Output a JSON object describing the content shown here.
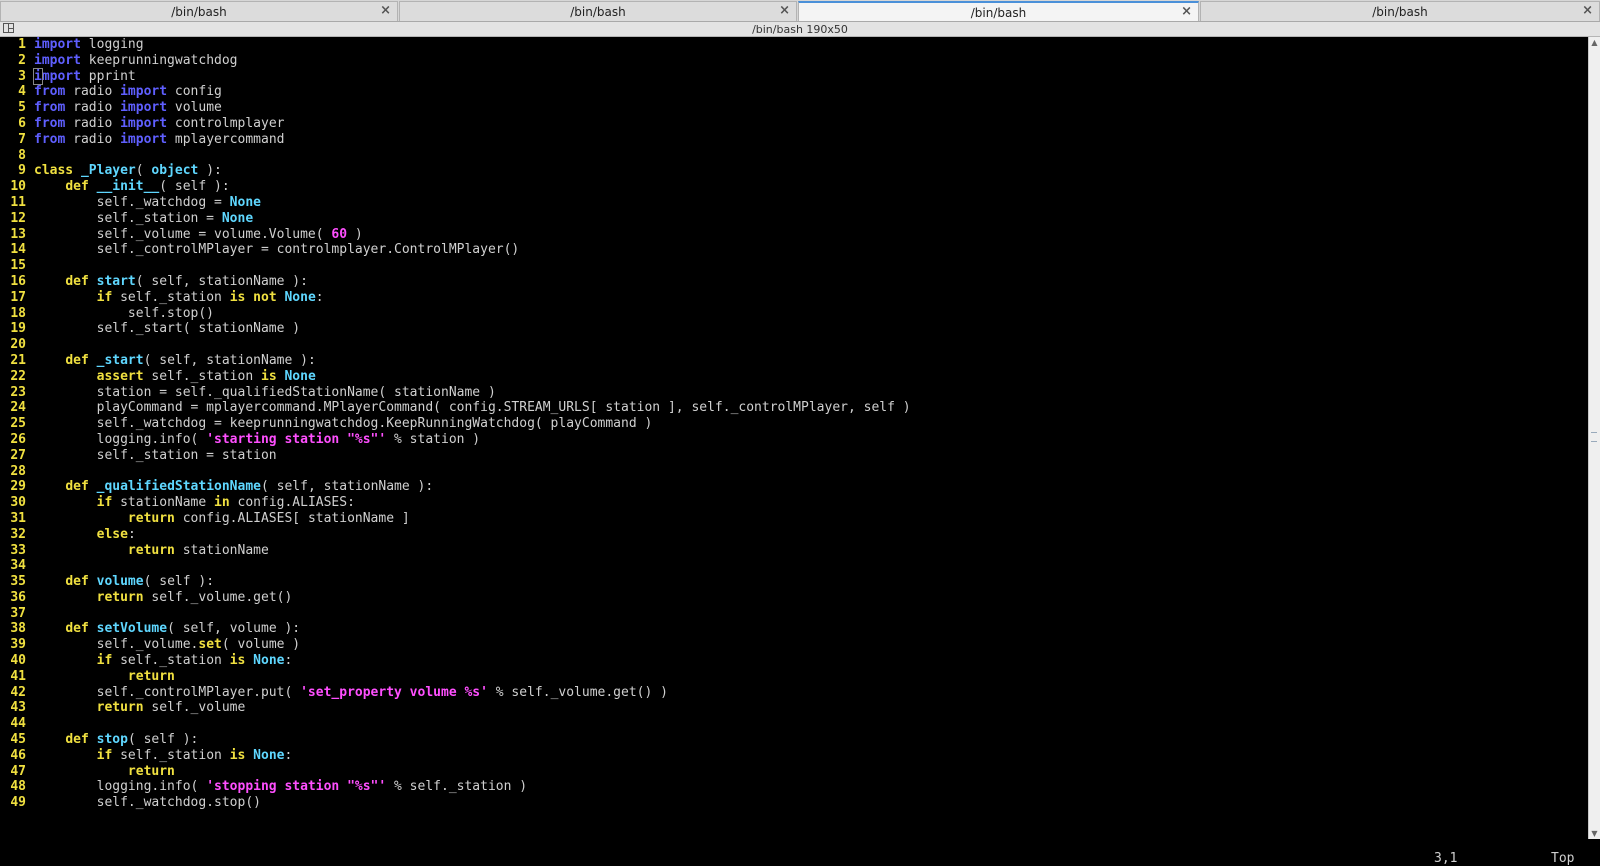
{
  "tabs": [
    {
      "label": "/bin/bash",
      "active": false
    },
    {
      "label": "/bin/bash",
      "active": false
    },
    {
      "label": "/bin/bash",
      "active": true
    },
    {
      "label": "/bin/bash",
      "active": false
    }
  ],
  "tab_close_icon": "×",
  "infobar": {
    "title": "/bin/bash 190x50"
  },
  "code_lines": [
    [
      [
        "kw",
        "import"
      ],
      [
        "n",
        " logging"
      ]
    ],
    [
      [
        "kw",
        "import"
      ],
      [
        "n",
        " keeprunningwatchdog"
      ]
    ],
    [
      [
        "kw",
        "import"
      ],
      [
        "n",
        " pprint"
      ]
    ],
    [
      [
        "kw",
        "from"
      ],
      [
        "n",
        " radio "
      ],
      [
        "kw",
        "import"
      ],
      [
        "n",
        " config"
      ]
    ],
    [
      [
        "kw",
        "from"
      ],
      [
        "n",
        " radio "
      ],
      [
        "kw",
        "import"
      ],
      [
        "n",
        " volume"
      ]
    ],
    [
      [
        "kw",
        "from"
      ],
      [
        "n",
        " radio "
      ],
      [
        "kw",
        "import"
      ],
      [
        "n",
        " controlmplayer"
      ]
    ],
    [
      [
        "kw",
        "from"
      ],
      [
        "n",
        " radio "
      ],
      [
        "kw",
        "import"
      ],
      [
        "n",
        " mplayercommand"
      ]
    ],
    [],
    [
      [
        "st",
        "class"
      ],
      [
        "n",
        " "
      ],
      [
        "fn",
        "_Player"
      ],
      [
        "n",
        "( "
      ],
      [
        "bi",
        "object"
      ],
      [
        "n",
        " ):"
      ]
    ],
    [
      [
        "n",
        "    "
      ],
      [
        "st",
        "def"
      ],
      [
        "n",
        " "
      ],
      [
        "fn",
        "__init__"
      ],
      [
        "n",
        "( self ):"
      ]
    ],
    [
      [
        "n",
        "        self._watchdog = "
      ],
      [
        "bi",
        "None"
      ]
    ],
    [
      [
        "n",
        "        self._station = "
      ],
      [
        "bi",
        "None"
      ]
    ],
    [
      [
        "n",
        "        self._volume = volume.Volume( "
      ],
      [
        "num",
        "60"
      ],
      [
        "n",
        " )"
      ]
    ],
    [
      [
        "n",
        "        self._controlMPlayer = controlmplayer.ControlMPlayer()"
      ]
    ],
    [],
    [
      [
        "n",
        "    "
      ],
      [
        "st",
        "def"
      ],
      [
        "n",
        " "
      ],
      [
        "fn",
        "start"
      ],
      [
        "n",
        "( self, stationName ):"
      ]
    ],
    [
      [
        "n",
        "        "
      ],
      [
        "st",
        "if"
      ],
      [
        "n",
        " self._station "
      ],
      [
        "st",
        "is not"
      ],
      [
        "n",
        " "
      ],
      [
        "bi",
        "None"
      ],
      [
        "n",
        ":"
      ]
    ],
    [
      [
        "n",
        "            self.stop()"
      ]
    ],
    [
      [
        "n",
        "        self._start( stationName )"
      ]
    ],
    [],
    [
      [
        "n",
        "    "
      ],
      [
        "st",
        "def"
      ],
      [
        "n",
        " "
      ],
      [
        "fn",
        "_start"
      ],
      [
        "n",
        "( self, stationName ):"
      ]
    ],
    [
      [
        "n",
        "        "
      ],
      [
        "st",
        "assert"
      ],
      [
        "n",
        " self._station "
      ],
      [
        "st",
        "is"
      ],
      [
        "n",
        " "
      ],
      [
        "bi",
        "None"
      ]
    ],
    [
      [
        "n",
        "        station = self._qualifiedStationName( stationName )"
      ]
    ],
    [
      [
        "n",
        "        playCommand = mplayercommand.MPlayerCommand( config.STREAM_URLS[ station ], self._controlMPlayer, self )"
      ]
    ],
    [
      [
        "n",
        "        self._watchdog = keeprunningwatchdog.KeepRunningWatchdog( playCommand )"
      ]
    ],
    [
      [
        "n",
        "        logging.info( "
      ],
      [
        "str",
        "'starting station \"%s\"'"
      ],
      [
        "n",
        " % station )"
      ]
    ],
    [
      [
        "n",
        "        self._station = station"
      ]
    ],
    [],
    [
      [
        "n",
        "    "
      ],
      [
        "st",
        "def"
      ],
      [
        "n",
        " "
      ],
      [
        "fn",
        "_qualifiedStationName"
      ],
      [
        "n",
        "( self, stationName ):"
      ]
    ],
    [
      [
        "n",
        "        "
      ],
      [
        "st",
        "if"
      ],
      [
        "n",
        " stationName "
      ],
      [
        "st",
        "in"
      ],
      [
        "n",
        " config.ALIASES:"
      ]
    ],
    [
      [
        "n",
        "            "
      ],
      [
        "st",
        "return"
      ],
      [
        "n",
        " config.ALIASES[ stationName ]"
      ]
    ],
    [
      [
        "n",
        "        "
      ],
      [
        "st",
        "else"
      ],
      [
        "n",
        ":"
      ]
    ],
    [
      [
        "n",
        "            "
      ],
      [
        "st",
        "return"
      ],
      [
        "n",
        " stationName"
      ]
    ],
    [],
    [
      [
        "n",
        "    "
      ],
      [
        "st",
        "def"
      ],
      [
        "n",
        " "
      ],
      [
        "fn",
        "volume"
      ],
      [
        "n",
        "( self ):"
      ]
    ],
    [
      [
        "n",
        "        "
      ],
      [
        "st",
        "return"
      ],
      [
        "n",
        " self._volume.get()"
      ]
    ],
    [],
    [
      [
        "n",
        "    "
      ],
      [
        "st",
        "def"
      ],
      [
        "n",
        " "
      ],
      [
        "fn",
        "setVolume"
      ],
      [
        "n",
        "( self, volume ):"
      ]
    ],
    [
      [
        "n",
        "        self._volume."
      ],
      [
        "st",
        "set"
      ],
      [
        "n",
        "( volume )"
      ]
    ],
    [
      [
        "n",
        "        "
      ],
      [
        "st",
        "if"
      ],
      [
        "n",
        " self._station "
      ],
      [
        "st",
        "is"
      ],
      [
        "n",
        " "
      ],
      [
        "bi",
        "None"
      ],
      [
        "n",
        ":"
      ]
    ],
    [
      [
        "n",
        "            "
      ],
      [
        "st",
        "return"
      ]
    ],
    [
      [
        "n",
        "        self._controlMPlayer.put( "
      ],
      [
        "str",
        "'set_property volume %s'"
      ],
      [
        "n",
        " % self._volume.get() )"
      ]
    ],
    [
      [
        "n",
        "        "
      ],
      [
        "st",
        "return"
      ],
      [
        "n",
        " self._volume"
      ]
    ],
    [],
    [
      [
        "n",
        "    "
      ],
      [
        "st",
        "def"
      ],
      [
        "n",
        " "
      ],
      [
        "fn",
        "stop"
      ],
      [
        "n",
        "( self ):"
      ]
    ],
    [
      [
        "n",
        "        "
      ],
      [
        "st",
        "if"
      ],
      [
        "n",
        " self._station "
      ],
      [
        "st",
        "is"
      ],
      [
        "n",
        " "
      ],
      [
        "bi",
        "None"
      ],
      [
        "n",
        ":"
      ]
    ],
    [
      [
        "n",
        "            "
      ],
      [
        "st",
        "return"
      ]
    ],
    [
      [
        "n",
        "        logging.info( "
      ],
      [
        "str",
        "'stopping station \"%s\"'"
      ],
      [
        "n",
        " % self._station )"
      ]
    ],
    [
      [
        "n",
        "        self._watchdog.stop()"
      ]
    ]
  ],
  "status": {
    "ruler": "3,1",
    "position": "Top"
  },
  "cursor": {
    "line": 3,
    "col": 1
  },
  "colors": {
    "keyword": "#5f5fff",
    "statement": "#f0e040",
    "function": "#5fd7ff",
    "string": "#ff4fff",
    "line_number": "#f0e040"
  },
  "icons": {
    "layout": "layout-split-icon",
    "scroll_up": "▲",
    "scroll_down": "▼"
  }
}
